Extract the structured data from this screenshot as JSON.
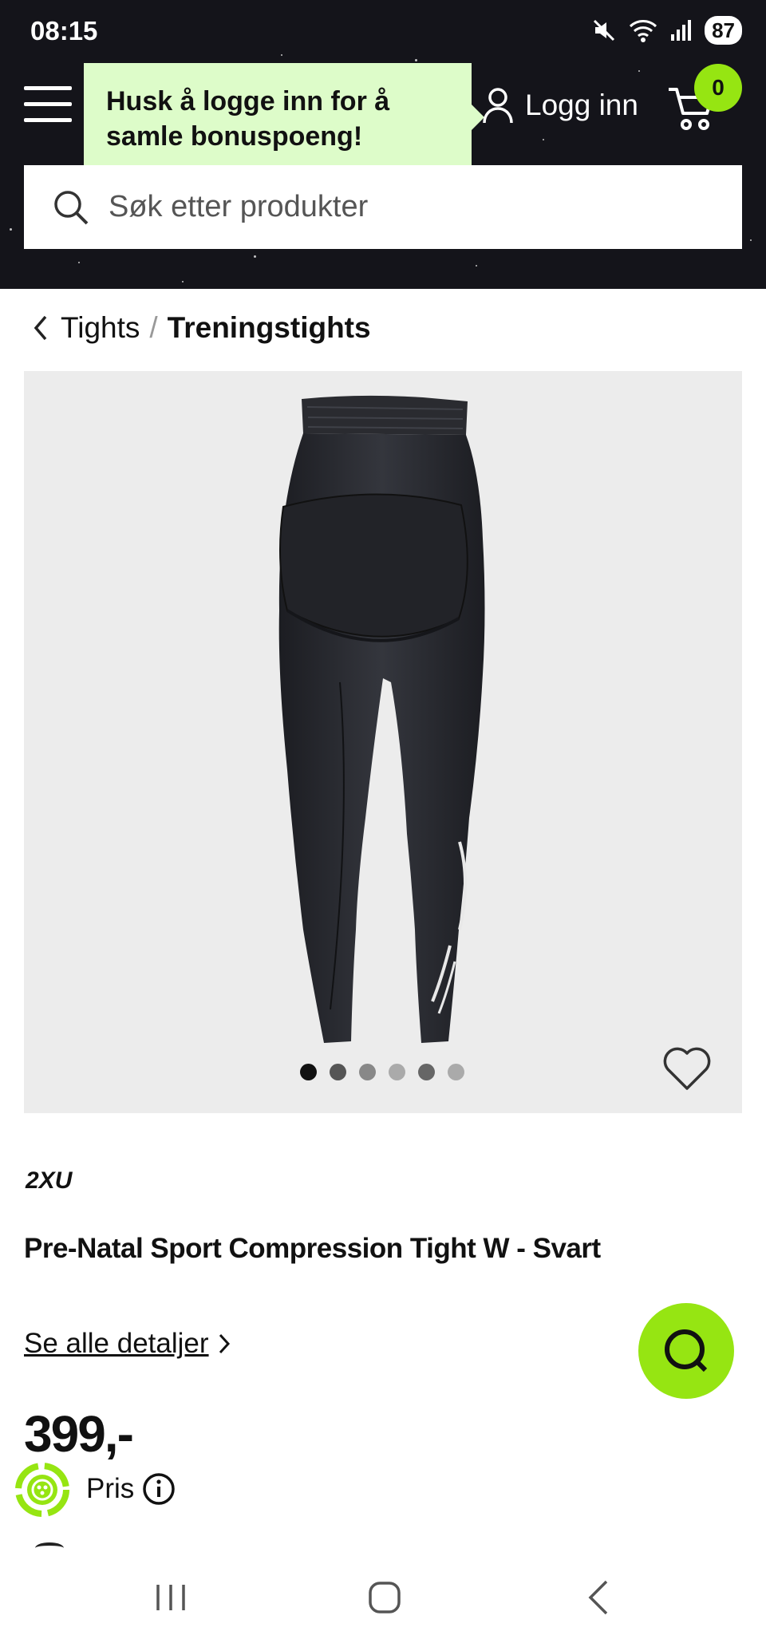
{
  "status_bar": {
    "time": "08:15",
    "battery": "87"
  },
  "header": {
    "tooltip": "Husk å logge inn for å samle bonuspoeng!",
    "login_label": "Logg inn",
    "cart_count": "0",
    "search_placeholder": "Søk etter produkter"
  },
  "breadcrumb": {
    "parent": "Tights",
    "separator": "/",
    "current": "Treningstights"
  },
  "product": {
    "brand": "2XU",
    "title": "Pre-Natal Sport Compression Tight W - Svart",
    "details_link": "Se alle detaljer",
    "price": "399,-",
    "price_label": "Pris",
    "image_count": 6,
    "active_image": 1
  },
  "colors": {
    "accent": "#96e512",
    "tooltip_bg": "#ddfcc9",
    "header_bg": "#14141a",
    "image_bg": "#ececec"
  },
  "icons": [
    "menu-icon",
    "user-icon",
    "cart-icon",
    "search-icon",
    "chevron-left-icon",
    "heart-icon",
    "chevron-right-icon",
    "chat-icon",
    "info-icon",
    "loyalty-icon"
  ]
}
